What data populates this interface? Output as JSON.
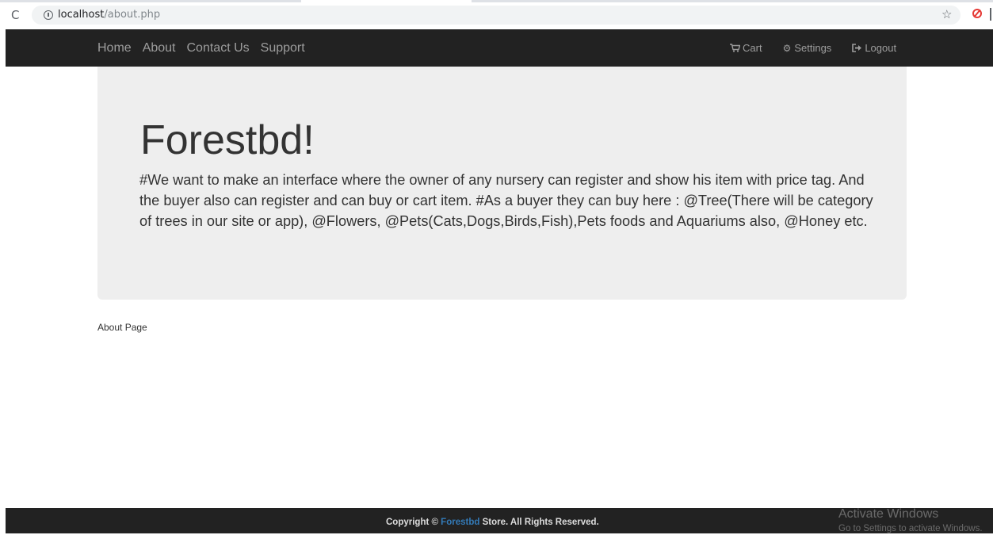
{
  "browser": {
    "reload_glyph": "C",
    "url_host": "localhost",
    "url_path": "/about.php",
    "star_glyph": "☆"
  },
  "navbar": {
    "links": [
      {
        "label": "Home"
      },
      {
        "label": "About"
      },
      {
        "label": "Contact Us"
      },
      {
        "label": "Support"
      }
    ],
    "cart_label": "Cart",
    "settings_label": "Settings",
    "logout_label": "Logout",
    "background": "#222222",
    "link_color": "#9d9d9d"
  },
  "jumbotron": {
    "title": "Forestbd!",
    "description": "#We want to make an interface where the owner of any nursery can register and show his item with price tag. And the buyer also can register and can buy or cart item. #As a buyer they can buy here : @Tree(There will be category of trees in our site or app), @Flowers, @Pets(Cats,Dogs,Birds,Fish),Pets foods and Aquariums also, @Honey etc.",
    "background": "#eeeeee"
  },
  "page": {
    "label": "About Page"
  },
  "footer": {
    "prefix": "Copyright © ",
    "brand": "Forestbd",
    "suffix": " Store. All Rights Reserved.",
    "brand_color": "#337ab7"
  },
  "watermark": {
    "line1": "Activate Windows",
    "line2": "Go to Settings to activate Windows."
  }
}
